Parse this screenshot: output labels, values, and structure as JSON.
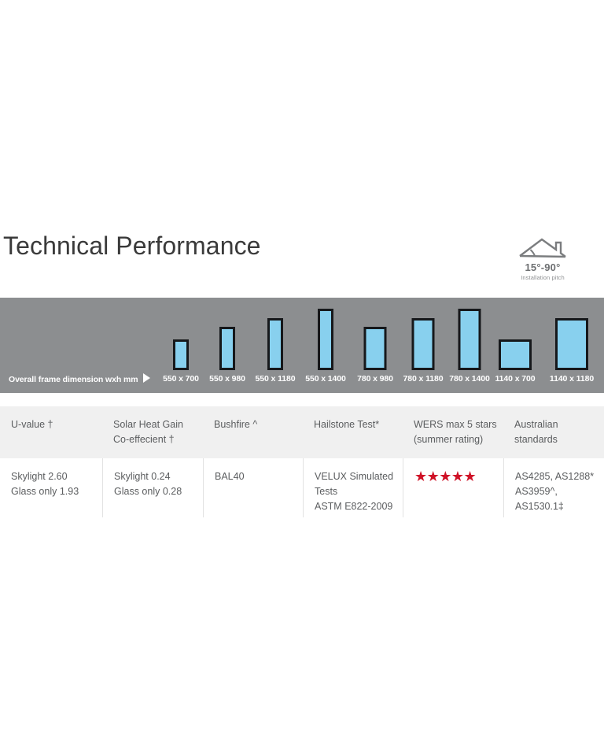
{
  "page": {
    "title": "Technical Performance"
  },
  "pitch_badge": {
    "icon": "roof-pitch-icon",
    "range": "15°-90°",
    "caption": "Installation pitch"
  },
  "size_bar": {
    "caption": "Overall frame dimension wxh mm",
    "arrow_icon": "play-triangle-icon",
    "background_color": "#8c8e90",
    "glass_color": "#88d0ee",
    "frame_color": "#16181b",
    "frames": [
      {
        "label": "550 x 700",
        "width_mm": 550,
        "height_mm": 700
      },
      {
        "label": "550 x 980",
        "width_mm": 550,
        "height_mm": 980
      },
      {
        "label": "550 x 1180",
        "width_mm": 550,
        "height_mm": 1180
      },
      {
        "label": "550 x 1400",
        "width_mm": 550,
        "height_mm": 1400
      },
      {
        "label": "780 x 980",
        "width_mm": 780,
        "height_mm": 980
      },
      {
        "label": "780 x 1180",
        "width_mm": 780,
        "height_mm": 1180
      },
      {
        "label": "780 x 1400",
        "width_mm": 780,
        "height_mm": 1400
      },
      {
        "label": "1140 x 700",
        "width_mm": 1140,
        "height_mm": 700
      },
      {
        "label": "1140 x 1180",
        "width_mm": 1140,
        "height_mm": 1180
      }
    ]
  },
  "spec_table": {
    "headers": [
      {
        "lines": [
          "U-value †"
        ]
      },
      {
        "lines": [
          "Solar Heat Gain",
          "Co-effecient †"
        ]
      },
      {
        "lines": [
          "Bushfire ^"
        ]
      },
      {
        "lines": [
          "Hailstone Test*"
        ]
      },
      {
        "lines": [
          "WERS max 5 stars",
          "(summer rating)"
        ]
      },
      {
        "lines": [
          "Australian",
          "standards"
        ]
      }
    ],
    "row": [
      {
        "lines": [
          "Skylight 2.60",
          "Glass only 1.93"
        ]
      },
      {
        "lines": [
          "Skylight 0.24",
          "Glass only 0.28"
        ]
      },
      {
        "lines": [
          "BAL40"
        ]
      },
      {
        "lines": [
          "VELUX Simulated",
          "Tests",
          "ASTM E822-2009"
        ]
      },
      {
        "stars": "★★★★★",
        "star_count": 5,
        "star_color": "#cf1126"
      },
      {
        "lines": [
          "AS4285, AS1288*",
          "AS3959^,",
          "AS1530.1‡"
        ]
      }
    ]
  }
}
